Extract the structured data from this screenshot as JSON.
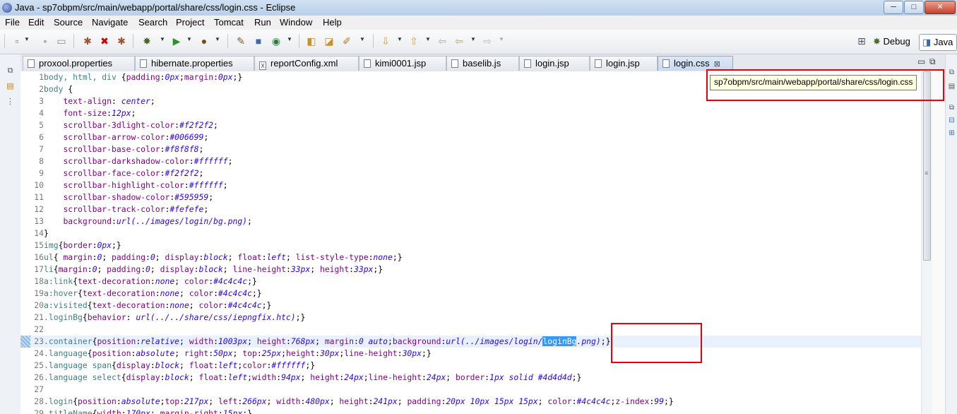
{
  "window": {
    "title": "Java - sp7obpm/src/main/webapp/portal/share/css/login.css - Eclipse",
    "min_label": "─",
    "max_label": "□",
    "close_label": "✕"
  },
  "menu": [
    "File",
    "Edit",
    "Source",
    "Navigate",
    "Search",
    "Project",
    "Tomcat",
    "Run",
    "Window",
    "Help"
  ],
  "perspectives": {
    "debug": "Debug",
    "java": "Java"
  },
  "tabs": [
    {
      "label": "proxool.properties",
      "icon": "properties-file-icon",
      "glyph": ""
    },
    {
      "label": "hibernate.properties",
      "icon": "properties-file-icon",
      "glyph": ""
    },
    {
      "label": "reportConfig.xml",
      "icon": "xml-file-icon",
      "glyph": "X"
    },
    {
      "label": "kimi0001.jsp",
      "icon": "jsp-file-icon",
      "glyph": ""
    },
    {
      "label": "baselib.js",
      "icon": "js-file-icon",
      "glyph": ""
    },
    {
      "label": "login.jsp",
      "icon": "jsp-file-icon",
      "glyph": ""
    },
    {
      "label": "login.jsp",
      "icon": "jsp-file-icon",
      "glyph": ""
    },
    {
      "label": "login.css",
      "icon": "css-file-icon",
      "glyph": "",
      "active": true,
      "close": "⊠"
    }
  ],
  "tooltip": "sp7obpm/src/main/webapp/portal/share/css/login.css",
  "code": [
    {
      "n": "1",
      "t": [
        [
          "body, html, div ",
          "sel"
        ],
        [
          "{",
          "br"
        ],
        [
          "padding",
          "prop"
        ],
        [
          ":",
          "p"
        ],
        [
          "0px",
          "val"
        ],
        [
          ";",
          "p"
        ],
        [
          "margin",
          "prop"
        ],
        [
          ":",
          "p"
        ],
        [
          "0px",
          "val"
        ],
        [
          ";",
          "p"
        ],
        [
          "}",
          "br"
        ]
      ]
    },
    {
      "n": "2",
      "t": [
        [
          "body ",
          "sel"
        ],
        [
          "{",
          "br"
        ]
      ]
    },
    {
      "n": "3",
      "t": [
        [
          "    ",
          "p"
        ],
        [
          "text-align",
          "prop"
        ],
        [
          ": ",
          "p"
        ],
        [
          "center",
          "val"
        ],
        [
          ";",
          "p"
        ]
      ]
    },
    {
      "n": "4",
      "t": [
        [
          "    ",
          "p"
        ],
        [
          "font-size",
          "prop"
        ],
        [
          ":",
          "p"
        ],
        [
          "12px",
          "val"
        ],
        [
          ";",
          "p"
        ]
      ]
    },
    {
      "n": "5",
      "t": [
        [
          "    ",
          "p"
        ],
        [
          "scrollbar-3dlight-color",
          "prop"
        ],
        [
          ":",
          "p"
        ],
        [
          "#f2f2f2",
          "val"
        ],
        [
          ";",
          "p"
        ]
      ]
    },
    {
      "n": "6",
      "t": [
        [
          "    ",
          "p"
        ],
        [
          "scrollbar-arrow-color",
          "prop"
        ],
        [
          ":",
          "p"
        ],
        [
          "#006699",
          "val"
        ],
        [
          ";",
          "p"
        ]
      ]
    },
    {
      "n": "7",
      "t": [
        [
          "    ",
          "p"
        ],
        [
          "scrollbar-base-color",
          "prop"
        ],
        [
          ":",
          "p"
        ],
        [
          "#f8f8f8",
          "val"
        ],
        [
          ";",
          "p"
        ]
      ]
    },
    {
      "n": "8",
      "t": [
        [
          "    ",
          "p"
        ],
        [
          "scrollbar-darkshadow-color",
          "prop"
        ],
        [
          ":",
          "p"
        ],
        [
          "#ffffff",
          "val"
        ],
        [
          ";",
          "p"
        ]
      ]
    },
    {
      "n": "9",
      "t": [
        [
          "    ",
          "p"
        ],
        [
          "scrollbar-face-color",
          "prop"
        ],
        [
          ":",
          "p"
        ],
        [
          "#f2f2f2",
          "val"
        ],
        [
          ";",
          "p"
        ]
      ]
    },
    {
      "n": "10",
      "t": [
        [
          "    ",
          "p"
        ],
        [
          "scrollbar-highlight-color",
          "prop"
        ],
        [
          ":",
          "p"
        ],
        [
          "#ffffff",
          "val"
        ],
        [
          ";",
          "p"
        ]
      ]
    },
    {
      "n": "11",
      "t": [
        [
          "    ",
          "p"
        ],
        [
          "scrollbar-shadow-color",
          "prop"
        ],
        [
          ":",
          "p"
        ],
        [
          "#595959",
          "val"
        ],
        [
          ";",
          "p"
        ]
      ]
    },
    {
      "n": "12",
      "t": [
        [
          "    ",
          "p"
        ],
        [
          "scrollbar-track-color",
          "prop"
        ],
        [
          ":",
          "p"
        ],
        [
          "#fefefe",
          "val"
        ],
        [
          ";",
          "p"
        ]
      ]
    },
    {
      "n": "13",
      "t": [
        [
          "    ",
          "p"
        ],
        [
          "background",
          "prop"
        ],
        [
          ":",
          "p"
        ],
        [
          "url(../images/login/bg.png)",
          "val"
        ],
        [
          ";",
          "p"
        ]
      ]
    },
    {
      "n": "14",
      "t": [
        [
          "}",
          "br"
        ]
      ]
    },
    {
      "n": "15",
      "t": [
        [
          "img",
          "sel"
        ],
        [
          "{",
          "br"
        ],
        [
          "border",
          "prop"
        ],
        [
          ":",
          "p"
        ],
        [
          "0px",
          "val"
        ],
        [
          ";",
          "p"
        ],
        [
          "}",
          "br"
        ]
      ]
    },
    {
      "n": "16",
      "t": [
        [
          "ul",
          "sel"
        ],
        [
          "{ ",
          "br"
        ],
        [
          "margin",
          "prop"
        ],
        [
          ":",
          "p"
        ],
        [
          "0",
          "val"
        ],
        [
          "; ",
          "p"
        ],
        [
          "padding",
          "prop"
        ],
        [
          ":",
          "p"
        ],
        [
          "0",
          "val"
        ],
        [
          "; ",
          "p"
        ],
        [
          "display",
          "prop"
        ],
        [
          ":",
          "p"
        ],
        [
          "block",
          "val"
        ],
        [
          "; ",
          "p"
        ],
        [
          "float",
          "prop"
        ],
        [
          ":",
          "p"
        ],
        [
          "left",
          "val"
        ],
        [
          "; ",
          "p"
        ],
        [
          "list-style-type",
          "prop"
        ],
        [
          ":",
          "p"
        ],
        [
          "none",
          "val"
        ],
        [
          ";",
          "p"
        ],
        [
          "}",
          "br"
        ]
      ]
    },
    {
      "n": "17",
      "t": [
        [
          "li",
          "sel"
        ],
        [
          "{",
          "br"
        ],
        [
          "margin",
          "prop"
        ],
        [
          ":",
          "p"
        ],
        [
          "0",
          "val"
        ],
        [
          "; ",
          "p"
        ],
        [
          "padding",
          "prop"
        ],
        [
          ":",
          "p"
        ],
        [
          "0",
          "val"
        ],
        [
          "; ",
          "p"
        ],
        [
          "display",
          "prop"
        ],
        [
          ":",
          "p"
        ],
        [
          "block",
          "val"
        ],
        [
          "; ",
          "p"
        ],
        [
          "line-height",
          "prop"
        ],
        [
          ":",
          "p"
        ],
        [
          "33px",
          "val"
        ],
        [
          "; ",
          "p"
        ],
        [
          "height",
          "prop"
        ],
        [
          ":",
          "p"
        ],
        [
          "33px",
          "val"
        ],
        [
          ";",
          "p"
        ],
        [
          "}",
          "br"
        ]
      ]
    },
    {
      "n": "18",
      "t": [
        [
          "a:link",
          "sel"
        ],
        [
          "{",
          "br"
        ],
        [
          "text-decoration",
          "prop"
        ],
        [
          ":",
          "p"
        ],
        [
          "none",
          "val"
        ],
        [
          "; ",
          "p"
        ],
        [
          "color",
          "prop"
        ],
        [
          ":",
          "p"
        ],
        [
          "#4c4c4c",
          "val"
        ],
        [
          ";",
          "p"
        ],
        [
          "}",
          "br"
        ]
      ]
    },
    {
      "n": "19",
      "t": [
        [
          "a:hover",
          "sel"
        ],
        [
          "{",
          "br"
        ],
        [
          "text-decoration",
          "prop"
        ],
        [
          ":",
          "p"
        ],
        [
          "none",
          "val"
        ],
        [
          "; ",
          "p"
        ],
        [
          "color",
          "prop"
        ],
        [
          ":",
          "p"
        ],
        [
          "#4c4c4c",
          "val"
        ],
        [
          ";",
          "p"
        ],
        [
          "}",
          "br"
        ]
      ]
    },
    {
      "n": "20",
      "t": [
        [
          "a:visited",
          "sel"
        ],
        [
          "{",
          "br"
        ],
        [
          "text-decoration",
          "prop"
        ],
        [
          ":",
          "p"
        ],
        [
          "none",
          "val"
        ],
        [
          "; ",
          "p"
        ],
        [
          "color",
          "prop"
        ],
        [
          ":",
          "p"
        ],
        [
          "#4c4c4c",
          "val"
        ],
        [
          ";",
          "p"
        ],
        [
          "}",
          "br"
        ]
      ]
    },
    {
      "n": "21",
      "t": [
        [
          ".loginBg",
          "sel"
        ],
        [
          "{",
          "br"
        ],
        [
          "behavior",
          "prop"
        ],
        [
          ": ",
          "p"
        ],
        [
          "url(../../share/css/iepngfix.htc)",
          "val"
        ],
        [
          ";",
          "p"
        ],
        [
          "}",
          "br"
        ]
      ]
    },
    {
      "n": "22",
      "t": []
    },
    {
      "n": "23",
      "cur": true,
      "t": [
        [
          ".container",
          "sel"
        ],
        [
          "{",
          "br"
        ],
        [
          "position",
          "prop"
        ],
        [
          ":",
          "p"
        ],
        [
          "relative",
          "val"
        ],
        [
          "; ",
          "p"
        ],
        [
          "width",
          "prop"
        ],
        [
          ":",
          "p"
        ],
        [
          "1003px",
          "val"
        ],
        [
          "; ",
          "p"
        ],
        [
          "height",
          "prop"
        ],
        [
          ":",
          "p"
        ],
        [
          "768px",
          "val"
        ],
        [
          "; ",
          "p"
        ],
        [
          "margin",
          "prop"
        ],
        [
          ":",
          "p"
        ],
        [
          "0 auto",
          "val"
        ],
        [
          ";",
          "p"
        ],
        [
          "background",
          "prop"
        ],
        [
          ":",
          "p"
        ],
        [
          "url(../images/login/",
          "val"
        ],
        [
          "loginBg",
          "hl"
        ],
        [
          ".png)",
          "val"
        ],
        [
          ";",
          "p"
        ],
        [
          "}",
          "br"
        ]
      ]
    },
    {
      "n": "24",
      "t": [
        [
          ".language",
          "sel"
        ],
        [
          "{",
          "br"
        ],
        [
          "position",
          "prop"
        ],
        [
          ":",
          "p"
        ],
        [
          "absolute",
          "val"
        ],
        [
          "; ",
          "p"
        ],
        [
          "right",
          "prop"
        ],
        [
          ":",
          "p"
        ],
        [
          "50px",
          "val"
        ],
        [
          "; ",
          "p"
        ],
        [
          "top",
          "prop"
        ],
        [
          ":",
          "p"
        ],
        [
          "25px",
          "val"
        ],
        [
          ";",
          "p"
        ],
        [
          "height",
          "prop"
        ],
        [
          ":",
          "p"
        ],
        [
          "30px",
          "val"
        ],
        [
          ";",
          "p"
        ],
        [
          "line-height",
          "prop"
        ],
        [
          ":",
          "p"
        ],
        [
          "30px",
          "val"
        ],
        [
          ";",
          "p"
        ],
        [
          "}",
          "br"
        ]
      ]
    },
    {
      "n": "25",
      "t": [
        [
          ".language span",
          "sel"
        ],
        [
          "{",
          "br"
        ],
        [
          "display",
          "prop"
        ],
        [
          ":",
          "p"
        ],
        [
          "block",
          "val"
        ],
        [
          "; ",
          "p"
        ],
        [
          "float",
          "prop"
        ],
        [
          ":",
          "p"
        ],
        [
          "left",
          "val"
        ],
        [
          ";",
          "p"
        ],
        [
          "color",
          "prop"
        ],
        [
          ":",
          "p"
        ],
        [
          "#ffffff",
          "val"
        ],
        [
          ";",
          "p"
        ],
        [
          "}",
          "br"
        ]
      ]
    },
    {
      "n": "26",
      "t": [
        [
          ".language select",
          "sel"
        ],
        [
          "{",
          "br"
        ],
        [
          "display",
          "prop"
        ],
        [
          ":",
          "p"
        ],
        [
          "block",
          "val"
        ],
        [
          "; ",
          "p"
        ],
        [
          "float",
          "prop"
        ],
        [
          ":",
          "p"
        ],
        [
          "left",
          "val"
        ],
        [
          ";",
          "p"
        ],
        [
          "width",
          "prop"
        ],
        [
          ":",
          "p"
        ],
        [
          "94px",
          "val"
        ],
        [
          "; ",
          "p"
        ],
        [
          "height",
          "prop"
        ],
        [
          ":",
          "p"
        ],
        [
          "24px",
          "val"
        ],
        [
          ";",
          "p"
        ],
        [
          "line-height",
          "prop"
        ],
        [
          ":",
          "p"
        ],
        [
          "24px",
          "val"
        ],
        [
          "; ",
          "p"
        ],
        [
          "border",
          "prop"
        ],
        [
          ":",
          "p"
        ],
        [
          "1px solid #4d4d4d",
          "val"
        ],
        [
          ";",
          "p"
        ],
        [
          "}",
          "br"
        ]
      ]
    },
    {
      "n": "27",
      "t": []
    },
    {
      "n": "28",
      "t": [
        [
          ".login",
          "sel"
        ],
        [
          "{",
          "br"
        ],
        [
          "position",
          "prop"
        ],
        [
          ":",
          "p"
        ],
        [
          "absolute",
          "val"
        ],
        [
          ";",
          "p"
        ],
        [
          "top",
          "prop"
        ],
        [
          ":",
          "p"
        ],
        [
          "217px",
          "val"
        ],
        [
          "; ",
          "p"
        ],
        [
          "left",
          "prop"
        ],
        [
          ":",
          "p"
        ],
        [
          "266px",
          "val"
        ],
        [
          "; ",
          "p"
        ],
        [
          "width",
          "prop"
        ],
        [
          ":",
          "p"
        ],
        [
          "480px",
          "val"
        ],
        [
          "; ",
          "p"
        ],
        [
          "height",
          "prop"
        ],
        [
          ":",
          "p"
        ],
        [
          "241px",
          "val"
        ],
        [
          "; ",
          "p"
        ],
        [
          "padding",
          "prop"
        ],
        [
          ":",
          "p"
        ],
        [
          "20px 10px 15px 15px",
          "val"
        ],
        [
          "; ",
          "p"
        ],
        [
          "color",
          "prop"
        ],
        [
          ":",
          "p"
        ],
        [
          "#4c4c4c",
          "val"
        ],
        [
          ";",
          "p"
        ],
        [
          "z-index",
          "prop"
        ],
        [
          ":",
          "p"
        ],
        [
          "99",
          "val"
        ],
        [
          ";",
          "p"
        ],
        [
          "}",
          "br"
        ]
      ]
    },
    {
      "n": "29",
      "t": [
        [
          ".titleName",
          "sel"
        ],
        [
          "{",
          "br"
        ],
        [
          "width",
          "prop"
        ],
        [
          ":",
          "p"
        ],
        [
          "170px",
          "val"
        ],
        [
          "; ",
          "p"
        ],
        [
          "margin-right",
          "prop"
        ],
        [
          ":",
          "p"
        ],
        [
          "15px",
          "val"
        ],
        [
          ";",
          "p"
        ],
        [
          "}",
          "br"
        ]
      ]
    }
  ]
}
